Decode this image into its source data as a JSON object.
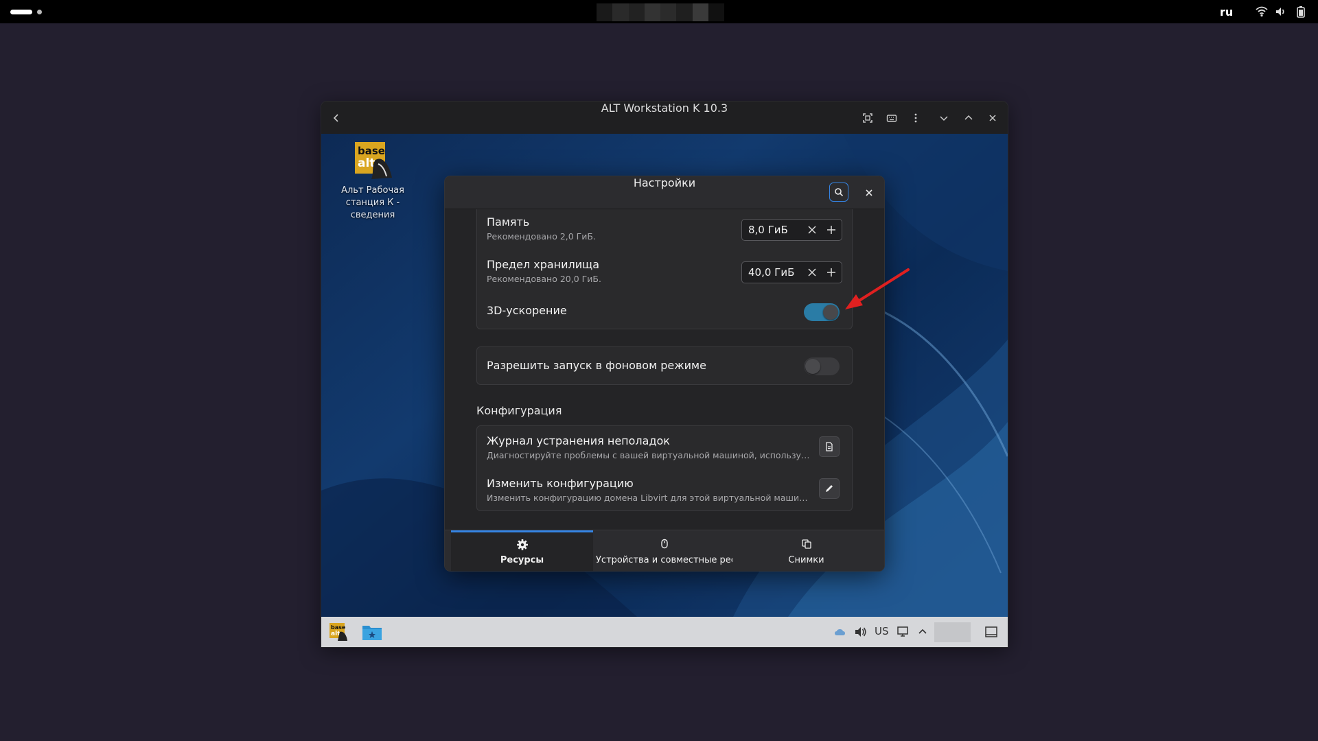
{
  "topbar": {
    "keyboard_language": "ru"
  },
  "vm_window": {
    "title": "ALT Workstation K 10.3"
  },
  "guest_desktop": {
    "icon_logo_text": "base alt",
    "icon_label": "Альт Рабочая станция К - сведения",
    "taskbar_layout": "US"
  },
  "settings": {
    "title": "Настройки",
    "memory": {
      "label": "Память",
      "hint": "Рекомендовано 2,0 ГиБ.",
      "value": "8,0 ГиБ"
    },
    "storage": {
      "label": "Предел хранилища",
      "hint": "Рекомендовано 20,0 ГиБ.",
      "value": "40,0 ГиБ"
    },
    "accel3d": {
      "label": "3D-ускорение",
      "enabled": true
    },
    "background": {
      "label": "Разрешить запуск в фоновом режиме",
      "enabled": false
    },
    "config_section": "Конфигурация",
    "troubleshoot": {
      "label": "Журнал устранения неполадок",
      "desc": "Диагностируйте проблемы с вашей виртуальной машиной, используя ф..."
    },
    "edit_config": {
      "label": "Изменить конфигурацию",
      "desc": "Изменить конфигурацию домена Libvirt для этой виртуальной машины."
    },
    "tabs": [
      {
        "label": "Ресурсы",
        "icon": "gear-icon",
        "active": true
      },
      {
        "label": "Устройства и совместные ресу...",
        "icon": "mouse-icon",
        "active": false
      },
      {
        "label": "Снимки",
        "icon": "snapshot-icon",
        "active": false
      }
    ]
  },
  "colors": {
    "accent": "#3584e4",
    "switch_on": "#2a7ca6",
    "annotation_arrow": "#e02020"
  }
}
